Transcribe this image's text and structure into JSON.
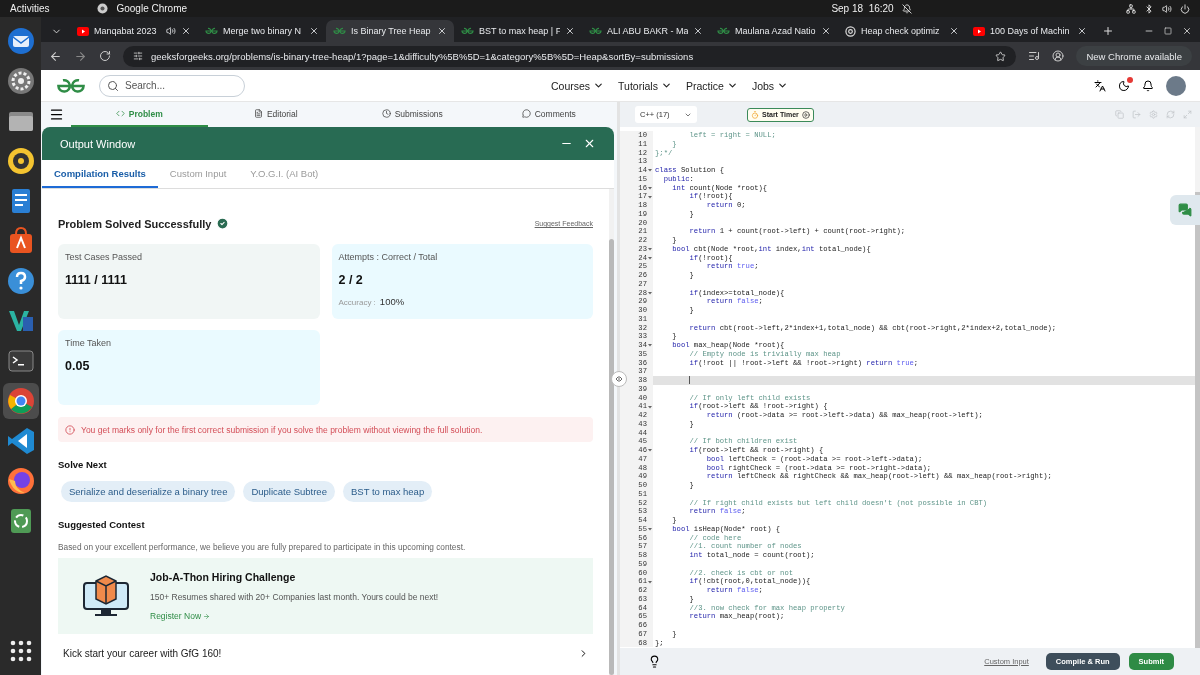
{
  "top_bar": {
    "activities": "Activities",
    "app": "Google Chrome",
    "clock": "Sep 18  16:20"
  },
  "dock": [
    {
      "kind": "mail",
      "selected": false
    },
    {
      "kind": "settings",
      "selected": false
    },
    {
      "kind": "files",
      "selected": false
    },
    {
      "kind": "music",
      "selected": false
    },
    {
      "kind": "document",
      "selected": false
    },
    {
      "kind": "store",
      "selected": false
    },
    {
      "kind": "help",
      "selected": false
    },
    {
      "kind": "teal-editor",
      "selected": false
    },
    {
      "kind": "terminal",
      "selected": false
    },
    {
      "kind": "browser",
      "selected": true
    },
    {
      "kind": "editor",
      "selected": false
    },
    {
      "kind": "firefox",
      "selected": false
    },
    {
      "kind": "trash",
      "selected": false
    },
    {
      "kind": "apps",
      "selected": false
    }
  ],
  "browser": {
    "tabs": [
      {
        "title": "Manqabat 2023",
        "kind": "video",
        "audio": true,
        "selected": false
      },
      {
        "title": "Merge two binary N",
        "kind": "gfg",
        "audio": false,
        "selected": false
      },
      {
        "title": "Is Binary Tree Heap",
        "kind": "gfg",
        "audio": false,
        "selected": true
      },
      {
        "title": "BST to max heap | F",
        "kind": "gfg",
        "audio": false,
        "selected": false
      },
      {
        "title": "ALI ABU BAKR - Ma",
        "kind": "gfg",
        "audio": false,
        "selected": false
      },
      {
        "title": "Maulana Azad Natio",
        "kind": "gfg",
        "audio": false,
        "selected": false
      },
      {
        "title": "Heap check optimiz",
        "kind": "generic",
        "audio": false,
        "selected": false
      },
      {
        "title": "100 Days of Machin",
        "kind": "video",
        "audio": false,
        "selected": false
      }
    ],
    "url": "geeksforgeeks.org/problems/is-binary-tree-heap/1?page=1&difficulty%5B%5D=1&category%5B%5D=Heap&sortBy=submissions",
    "update": "New Chrome available"
  },
  "site_header": {
    "search_placeholder": "Search...",
    "nav": [
      {
        "label": "Courses"
      },
      {
        "label": "Tutorials"
      },
      {
        "label": "Practice"
      },
      {
        "label": "Jobs"
      }
    ],
    "theme_alert": true
  },
  "problem_tabs": [
    {
      "label": "Problem",
      "selected": true
    },
    {
      "label": "Editorial",
      "selected": false
    },
    {
      "label": "Submissions",
      "selected": false
    },
    {
      "label": "Comments",
      "selected": false
    }
  ],
  "output": {
    "title": "Output Window",
    "tabs": [
      {
        "label": "Compilation Results",
        "selected": true
      },
      {
        "label": "Custom Input",
        "selected": false
      },
      {
        "label": "Y.O.G.I. (AI Bot)",
        "selected": false
      }
    ],
    "status": "Problem Solved Successfully",
    "feedback": "Suggest Feedback",
    "cards": [
      {
        "kind": "neutral",
        "label": "Test Cases Passed",
        "value": "1111 / 1111"
      },
      {
        "kind": "info",
        "label": "Attempts : Correct / Total",
        "value": "2 / 2",
        "note_label": "Accuracy :",
        "note_value": "100%"
      },
      {
        "kind": "info",
        "label": "Time Taken",
        "value": "0.05"
      }
    ],
    "warning": "You get marks only for the first correct submission if you solve the problem without viewing the full solution.",
    "solve_next": {
      "title": "Solve Next",
      "items": [
        "Serialize and deserialize a binary tree",
        "Duplicate Subtree",
        "BST to max heap"
      ]
    },
    "contest": {
      "title": "Suggested Contest",
      "intro": "Based on your excellent performance, we believe you are fully prepared to participate in this upcoming contest.",
      "name": "Job-A-Thon Hiring Challenge",
      "description": "150+ Resumes shared with 20+ Companies last month. Yours could be next!",
      "link": "Register Now"
    },
    "career": "Kick start your career with GfG 160!"
  },
  "editor": {
    "language": "C++ (17)",
    "timer": "Start Timer",
    "lines": [
      {
        "number": "10",
        "foldable": false,
        "current": false,
        "segments": [
          {
            "kind": "comment",
            "text": "        left = right = NULL;"
          }
        ]
      },
      {
        "number": "11",
        "foldable": false,
        "current": false,
        "segments": [
          {
            "kind": "comment",
            "text": "    }"
          }
        ]
      },
      {
        "number": "12",
        "foldable": false,
        "current": false,
        "segments": [
          {
            "kind": "comment",
            "text": "};*/"
          }
        ]
      },
      {
        "number": "13",
        "foldable": false,
        "current": false
      },
      {
        "number": "14",
        "foldable": true,
        "current": false,
        "segments": [
          {
            "kind": "keyword",
            "text": "class"
          },
          {
            "kind": "plain",
            "text": " Solution {"
          }
        ]
      },
      {
        "number": "15",
        "foldable": false,
        "current": false,
        "segments": [
          {
            "kind": "keyword",
            "text": "  public"
          },
          {
            "kind": "plain",
            "text": ":"
          }
        ]
      },
      {
        "number": "16",
        "foldable": true,
        "current": false,
        "segments": [
          {
            "kind": "keyword",
            "text": "    int"
          },
          {
            "kind": "plain",
            "text": " count(Node *root){"
          }
        ]
      },
      {
        "number": "17",
        "foldable": true,
        "current": false,
        "segments": [
          {
            "kind": "keyword",
            "text": "        if"
          },
          {
            "kind": "plain",
            "text": "(!root){"
          }
        ]
      },
      {
        "number": "18",
        "foldable": false,
        "current": false,
        "segments": [
          {
            "kind": "keyword",
            "text": "            return"
          },
          {
            "kind": "plain",
            "text": " 0;"
          }
        ]
      },
      {
        "number": "19",
        "foldable": false,
        "current": false,
        "segments": [
          {
            "kind": "plain",
            "text": "        }"
          }
        ]
      },
      {
        "number": "20",
        "foldable": false,
        "current": false
      },
      {
        "number": "21",
        "foldable": false,
        "current": false,
        "segments": [
          {
            "kind": "keyword",
            "text": "        return"
          },
          {
            "kind": "plain",
            "text": " 1 + count(root->left) + count(root->right);"
          }
        ]
      },
      {
        "number": "22",
        "foldable": false,
        "current": false,
        "segments": [
          {
            "kind": "plain",
            "text": "    }"
          }
        ]
      },
      {
        "number": "23",
        "foldable": true,
        "current": false,
        "segments": [
          {
            "kind": "keyword",
            "text": "    bool"
          },
          {
            "kind": "plain",
            "text": " cbt(Node *root,"
          },
          {
            "kind": "keyword",
            "text": "int"
          },
          {
            "kind": "plain",
            "text": " index,"
          },
          {
            "kind": "keyword",
            "text": "int"
          },
          {
            "kind": "plain",
            "text": " total_node){"
          }
        ]
      },
      {
        "number": "24",
        "foldable": true,
        "current": false,
        "segments": [
          {
            "kind": "keyword",
            "text": "        if"
          },
          {
            "kind": "plain",
            "text": "(!root){"
          }
        ]
      },
      {
        "number": "25",
        "foldable": false,
        "current": false,
        "segments": [
          {
            "kind": "keyword",
            "text": "            return"
          },
          {
            "kind": "literal",
            "text": " true"
          },
          {
            "kind": "plain",
            "text": ";"
          }
        ]
      },
      {
        "number": "26",
        "foldable": false,
        "current": false,
        "segments": [
          {
            "kind": "plain",
            "text": "        }"
          }
        ]
      },
      {
        "number": "27",
        "foldable": false,
        "current": false
      },
      {
        "number": "28",
        "foldable": true,
        "current": false,
        "segments": [
          {
            "kind": "keyword",
            "text": "        if"
          },
          {
            "kind": "plain",
            "text": "(index>=total_node){"
          }
        ]
      },
      {
        "number": "29",
        "foldable": false,
        "current": false,
        "segments": [
          {
            "kind": "keyword",
            "text": "            return"
          },
          {
            "kind": "literal",
            "text": " false"
          },
          {
            "kind": "plain",
            "text": ";"
          }
        ]
      },
      {
        "number": "30",
        "foldable": false,
        "current": false,
        "segments": [
          {
            "kind": "plain",
            "text": "        }"
          }
        ]
      },
      {
        "number": "31",
        "foldable": false,
        "current": false
      },
      {
        "number": "32",
        "foldable": false,
        "current": false,
        "segments": [
          {
            "kind": "keyword",
            "text": "        return"
          },
          {
            "kind": "plain",
            "text": " cbt(root->left,2*index+1,total_node) && cbt(root->right,2*index+2,total_node);"
          }
        ]
      },
      {
        "number": "33",
        "foldable": false,
        "current": false,
        "segments": [
          {
            "kind": "plain",
            "text": "    }"
          }
        ]
      },
      {
        "number": "34",
        "foldable": true,
        "current": false,
        "segments": [
          {
            "kind": "keyword",
            "text": "    bool"
          },
          {
            "kind": "plain",
            "text": " max_heap(Node *root){"
          }
        ]
      },
      {
        "number": "35",
        "foldable": false,
        "current": false,
        "segments": [
          {
            "kind": "comment",
            "text": "        // Empty node is trivially max heap"
          }
        ]
      },
      {
        "number": "36",
        "foldable": false,
        "current": false,
        "segments": [
          {
            "kind": "keyword",
            "text": "        if"
          },
          {
            "kind": "plain",
            "text": "(!root || !root->left && !root->right) "
          },
          {
            "kind": "keyword",
            "text": "return"
          },
          {
            "kind": "literal",
            "text": " true"
          },
          {
            "kind": "plain",
            "text": ";"
          }
        ]
      },
      {
        "number": "37",
        "foldable": false,
        "current": false
      },
      {
        "number": "38",
        "foldable": false,
        "current": true
      },
      {
        "number": "39",
        "foldable": false,
        "current": false
      },
      {
        "number": "40",
        "foldable": false,
        "current": false,
        "segments": [
          {
            "kind": "comment",
            "text": "        // If only left child exists"
          }
        ]
      },
      {
        "number": "41",
        "foldable": true,
        "current": false,
        "segments": [
          {
            "kind": "keyword",
            "text": "        if"
          },
          {
            "kind": "plain",
            "text": "(root->left && !root->right) {"
          }
        ]
      },
      {
        "number": "42",
        "foldable": false,
        "current": false,
        "segments": [
          {
            "kind": "keyword",
            "text": "            return"
          },
          {
            "kind": "plain",
            "text": " (root->data >= root->left->data) && max_heap(root->left);"
          }
        ]
      },
      {
        "number": "43",
        "foldable": false,
        "current": false,
        "segments": [
          {
            "kind": "plain",
            "text": "        }"
          }
        ]
      },
      {
        "number": "44",
        "foldable": false,
        "current": false
      },
      {
        "number": "45",
        "foldable": false,
        "current": false,
        "segments": [
          {
            "kind": "comment",
            "text": "        // If both children exist"
          }
        ]
      },
      {
        "number": "46",
        "foldable": true,
        "current": false,
        "segments": [
          {
            "kind": "keyword",
            "text": "        if"
          },
          {
            "kind": "plain",
            "text": "(root->left && root->right) {"
          }
        ]
      },
      {
        "number": "47",
        "foldable": false,
        "current": false,
        "segments": [
          {
            "kind": "keyword",
            "text": "            bool"
          },
          {
            "kind": "plain",
            "text": " leftCheck = (root->data >= root->left->data);"
          }
        ]
      },
      {
        "number": "48",
        "foldable": false,
        "current": false,
        "segments": [
          {
            "kind": "keyword",
            "text": "            bool"
          },
          {
            "kind": "plain",
            "text": " rightCheck = (root->data >= root->right->data);"
          }
        ]
      },
      {
        "number": "49",
        "foldable": false,
        "current": false,
        "segments": [
          {
            "kind": "keyword",
            "text": "            return"
          },
          {
            "kind": "plain",
            "text": " leftCheck && rightCheck && max_heap(root->left) && max_heap(root->right);"
          }
        ]
      },
      {
        "number": "50",
        "foldable": false,
        "current": false,
        "segments": [
          {
            "kind": "plain",
            "text": "        }"
          }
        ]
      },
      {
        "number": "51",
        "foldable": false,
        "current": false
      },
      {
        "number": "52",
        "foldable": false,
        "current": false,
        "segments": [
          {
            "kind": "comment",
            "text": "        // If right child exists but left child doesn't (not possible in CBT)"
          }
        ]
      },
      {
        "number": "53",
        "foldable": false,
        "current": false,
        "segments": [
          {
            "kind": "keyword",
            "text": "        return"
          },
          {
            "kind": "literal",
            "text": " false"
          },
          {
            "kind": "plain",
            "text": ";"
          }
        ]
      },
      {
        "number": "54",
        "foldable": false,
        "current": false,
        "segments": [
          {
            "kind": "plain",
            "text": "    }"
          }
        ]
      },
      {
        "number": "55",
        "foldable": true,
        "current": false,
        "segments": [
          {
            "kind": "keyword",
            "text": "    bool"
          },
          {
            "kind": "plain",
            "text": " isHeap(Node* root) {"
          }
        ]
      },
      {
        "number": "56",
        "foldable": false,
        "current": false,
        "segments": [
          {
            "kind": "comment",
            "text": "        // code here"
          }
        ]
      },
      {
        "number": "57",
        "foldable": false,
        "current": false,
        "segments": [
          {
            "kind": "comment",
            "text": "        //1. count number of nodes"
          }
        ]
      },
      {
        "number": "58",
        "foldable": false,
        "current": false,
        "segments": [
          {
            "kind": "keyword",
            "text": "        int"
          },
          {
            "kind": "plain",
            "text": " total_node = count(root);"
          }
        ]
      },
      {
        "number": "59",
        "foldable": false,
        "current": false
      },
      {
        "number": "60",
        "foldable": false,
        "current": false,
        "segments": [
          {
            "kind": "comment",
            "text": "        //2. check is cbt or not"
          }
        ]
      },
      {
        "number": "61",
        "foldable": true,
        "current": false,
        "segments": [
          {
            "kind": "keyword",
            "text": "        if"
          },
          {
            "kind": "plain",
            "text": "(!cbt(root,0,total_node)){"
          }
        ]
      },
      {
        "number": "62",
        "foldable": false,
        "current": false,
        "segments": [
          {
            "kind": "keyword",
            "text": "            return"
          },
          {
            "kind": "literal",
            "text": " false"
          },
          {
            "kind": "plain",
            "text": ";"
          }
        ]
      },
      {
        "number": "63",
        "foldable": false,
        "current": false,
        "segments": [
          {
            "kind": "plain",
            "text": "        }"
          }
        ]
      },
      {
        "number": "64",
        "foldable": false,
        "current": false,
        "segments": [
          {
            "kind": "comment",
            "text": "        //3. now check for max heap property"
          }
        ]
      },
      {
        "number": "65",
        "foldable": false,
        "current": false,
        "segments": [
          {
            "kind": "keyword",
            "text": "        return"
          },
          {
            "kind": "plain",
            "text": " max_heap(root);"
          }
        ]
      },
      {
        "number": "66",
        "foldable": false,
        "current": false
      },
      {
        "number": "67",
        "foldable": false,
        "current": false,
        "segments": [
          {
            "kind": "plain",
            "text": "    }"
          }
        ]
      },
      {
        "number": "68",
        "foldable": false,
        "current": false,
        "segments": [
          {
            "kind": "plain",
            "text": "};"
          }
        ]
      }
    ],
    "custom_input": "Custom Input",
    "run": "Compile & Run",
    "submit": "Submit"
  }
}
